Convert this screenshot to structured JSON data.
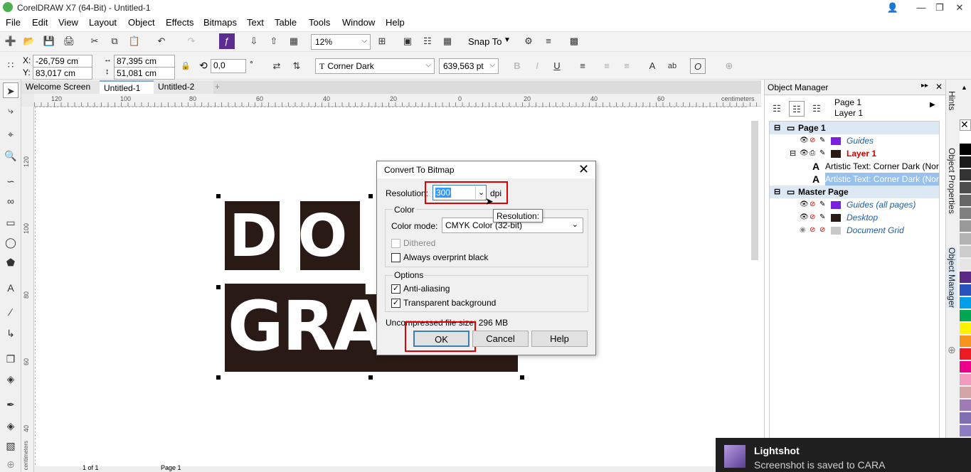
{
  "window": {
    "title": "CorelDRAW X7 (64-Bit) - Untitled-1"
  },
  "menu": [
    "File",
    "Edit",
    "View",
    "Layout",
    "Object",
    "Effects",
    "Bitmaps",
    "Text",
    "Table",
    "Tools",
    "Window",
    "Help"
  ],
  "toolbar": {
    "zoom": "12%",
    "snap_label": "Snap To"
  },
  "property_bar": {
    "x": "-26,759 cm",
    "y": "83,017 cm",
    "x_label": "X:",
    "y_label": "Y:",
    "width": "87,395 cm",
    "height": "51,081 cm",
    "angle": "0,0",
    "angle_unit": "°",
    "font": "Corner Dark",
    "font_size": "639,563 pt"
  },
  "doc_tabs": [
    "Welcome Screen",
    "Untitled-1",
    "Untitled-2"
  ],
  "ruler": {
    "h_ticks": [
      "120",
      "100",
      "80",
      "60",
      "40",
      "20",
      "0",
      "20",
      "40",
      "60",
      "80",
      "100",
      "120"
    ],
    "unit": "centimeters",
    "v_ticks": [
      "120",
      "100",
      "80",
      "60",
      "40"
    ],
    "v_unit": "centimeters"
  },
  "artwork_text": {
    "line1": "D O",
    "line2": "GRA"
  },
  "object_manager": {
    "title": "Object Manager",
    "page_info": [
      "Page 1",
      "Layer 1"
    ],
    "tree": [
      {
        "label": "Page 1",
        "level": 0,
        "swatch": ""
      },
      {
        "label": "Guides",
        "level": 1,
        "swatch": "#7b1fe0"
      },
      {
        "label": "Layer 1",
        "level": 1,
        "swatch": "#2a1a16"
      },
      {
        "label": "Artistic Text: Corner Dark (Norm",
        "level": 2,
        "swatch": ""
      },
      {
        "label": "Artistic Text: Corner Dark (Norm",
        "level": 2,
        "swatch": ""
      },
      {
        "label": "Master Page",
        "level": 0,
        "swatch": ""
      },
      {
        "label": "Guides (all pages)",
        "level": 1,
        "swatch": "#7b1fe0"
      },
      {
        "label": "Desktop",
        "level": 1,
        "swatch": "#2a1a16"
      },
      {
        "label": "Document Grid",
        "level": 1,
        "swatch": "#c8c8c8"
      }
    ]
  },
  "docker_tabs": [
    "Hints",
    "Object Properties",
    "Object Manager"
  ],
  "palette": [
    "#ffffff",
    "#000000",
    "#1a1a1a",
    "#333333",
    "#4d4d4d",
    "#666666",
    "#808080",
    "#999999",
    "#b3b3b3",
    "#cccccc",
    "#e6e6e6",
    "#5b2a86",
    "#2a52be",
    "#00a0e9",
    "#00a651",
    "#fff200",
    "#f7941d",
    "#ed1c24",
    "#ec008c",
    "#f49ac1",
    "#d4a5a5",
    "#9e7bb5",
    "#7f6fb2",
    "#8e7cc3",
    "#6b5ca5",
    "#9a8c98"
  ],
  "dialog": {
    "title": "Convert To Bitmap",
    "resolution_label": "Resolution:",
    "resolution_value": "300",
    "resolution_unit": "dpi",
    "color_group": "Color",
    "color_mode_label": "Color mode:",
    "color_mode_value": "CMYK Color (32-bit)",
    "dithered_label": "Dithered",
    "overprint_label": "Always overprint black",
    "options_group": "Options",
    "antialias_label": "Anti-aliasing",
    "transparent_label": "Transparent background",
    "filesize": "Uncompressed file size: 296 MB",
    "ok": "OK",
    "cancel": "Cancel",
    "help": "Help"
  },
  "tooltip": "Resolution:",
  "status": {
    "page": "Page 1",
    "pager": "1 of 1"
  },
  "toast": {
    "title": "Lightshot",
    "message": "Screenshot is saved to CARA"
  }
}
